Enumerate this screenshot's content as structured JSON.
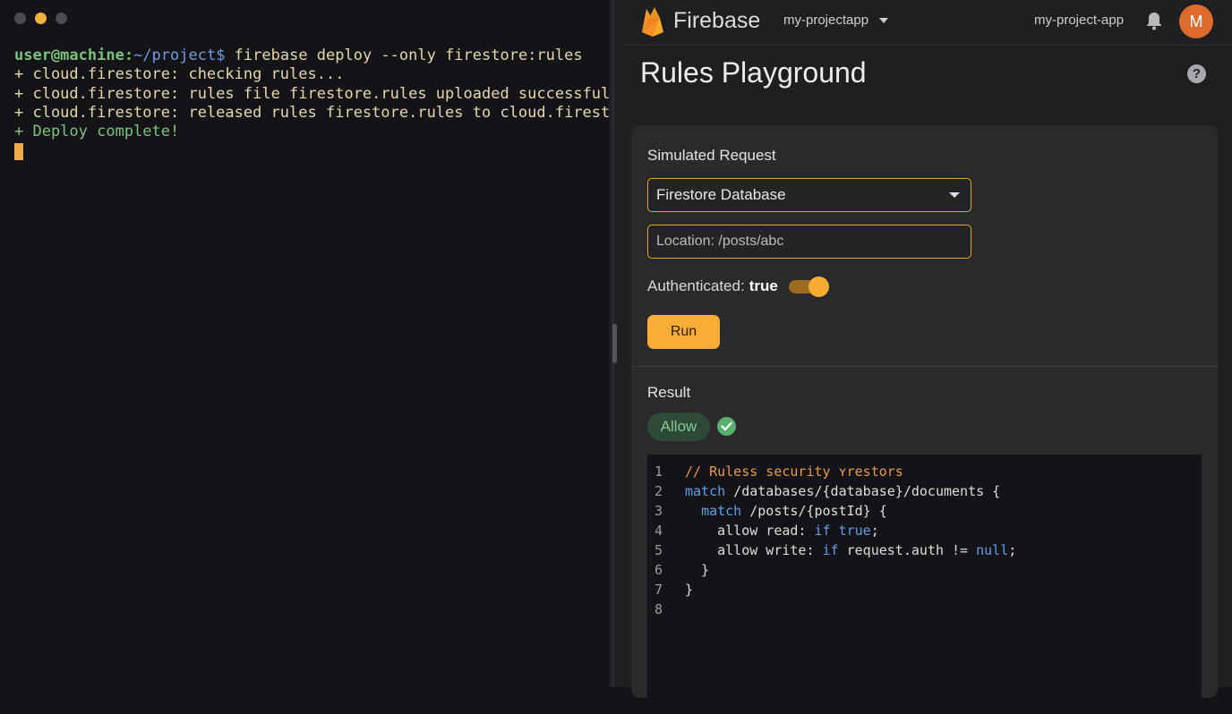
{
  "terminal": {
    "prompt_user": "user@machine",
    "prompt_sep": ":",
    "prompt_path": "~/project$",
    "command": " firebase deploy --only firestore:rules",
    "output": [
      "+ cloud.firestore: checking rules...",
      "+ cloud.firestore: rules file firestore.rules uploaded successfully.",
      "+ cloud.firestore: released rules firestore.rules to cloud.firestore"
    ],
    "done": "+ Deploy complete!",
    "window_dot_colors": [
      "#4a4a4f",
      "#f2b13a",
      "#4a4a4f"
    ]
  },
  "header": {
    "brand": "Firebase",
    "project_selector": "my-projectapp",
    "project_name": "my-project-app",
    "avatar_initial": "M",
    "bell_icon": "notifications-icon",
    "logo_icon": "firebase-flame-icon"
  },
  "page": {
    "title": "Rules Playground",
    "help_icon": "help-icon",
    "help_glyph": "?"
  },
  "request": {
    "heading": "Simulated Request",
    "service": "Firestore Database",
    "location": "Location: /posts/abc",
    "auth_label": "Authenticated:",
    "auth_value": "true",
    "auth_enabled": true,
    "run_label": "Run"
  },
  "result": {
    "heading": "Result",
    "status": "Allow",
    "status_icon": "check-circle-icon"
  },
  "code": {
    "lines": [
      {
        "n": "1",
        "parts": [
          {
            "t": "// Ruless security ʏrestors",
            "c": "comment"
          }
        ]
      },
      {
        "n": "2",
        "parts": [
          {
            "t": "match",
            "c": "kw"
          },
          {
            "t": " /databases/{database}/documents {",
            "c": "txt"
          }
        ]
      },
      {
        "n": "3",
        "parts": [
          {
            "t": "  ",
            "c": "txt"
          },
          {
            "t": "match",
            "c": "kw"
          },
          {
            "t": " /posts/{postId} {",
            "c": "txt"
          }
        ]
      },
      {
        "n": "4",
        "parts": [
          {
            "t": "    allow read: ",
            "c": "txt"
          },
          {
            "t": "if true",
            "c": "kw"
          },
          {
            "t": ";",
            "c": "txt"
          }
        ]
      },
      {
        "n": "5",
        "parts": [
          {
            "t": "    allow write: ",
            "c": "txt"
          },
          {
            "t": "if",
            "c": "kw"
          },
          {
            "t": " request.auth != ",
            "c": "txt"
          },
          {
            "t": "null",
            "c": "kw"
          },
          {
            "t": ";",
            "c": "txt"
          }
        ]
      },
      {
        "n": "6",
        "parts": [
          {
            "t": "  }",
            "c": "txt"
          }
        ]
      },
      {
        "n": "7",
        "parts": [
          {
            "t": "}",
            "c": "txt"
          }
        ]
      },
      {
        "n": "8",
        "parts": []
      }
    ]
  },
  "colors": {
    "accent": "#f6ad32",
    "allow_bg": "#2d4a36",
    "allow_text": "#87c898",
    "avatar_bg": "#de6a2c"
  }
}
